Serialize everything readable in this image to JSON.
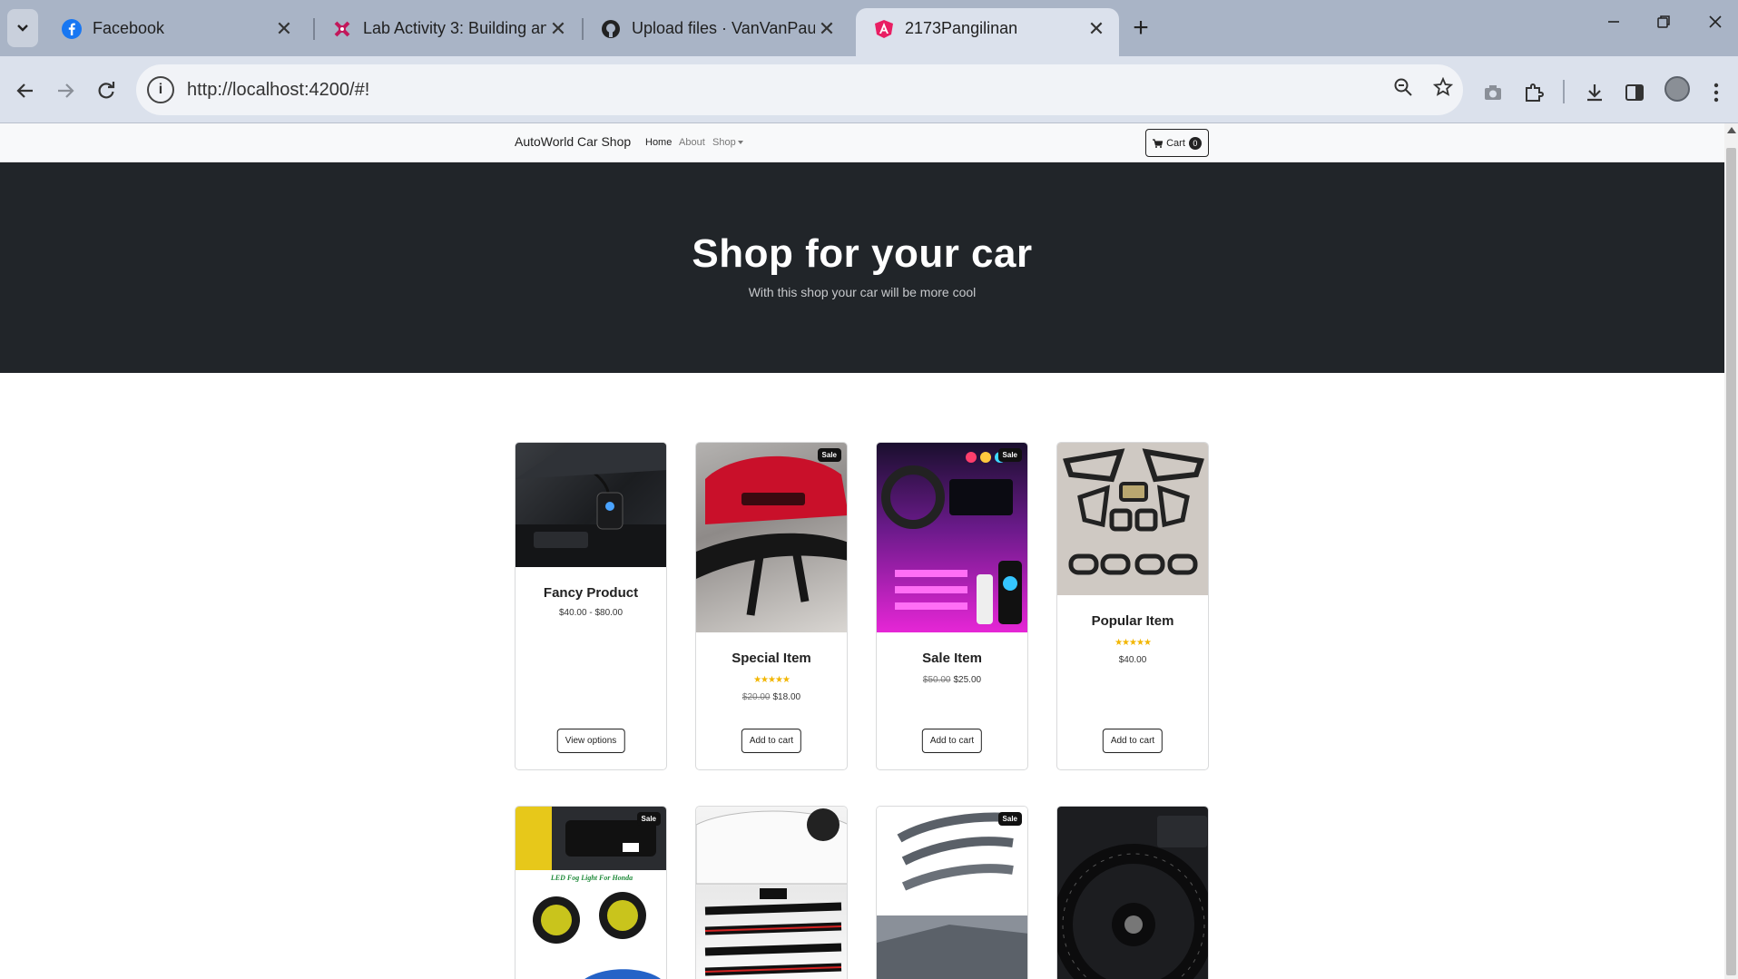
{
  "browser": {
    "tabs": [
      {
        "title": "Facebook",
        "favicon": "facebook-icon",
        "active": false
      },
      {
        "title": "Lab Activity 3: Building an SPA f",
        "favicon": "lab-icon",
        "active": false
      },
      {
        "title": "Upload files · VanVanPaulPaul/L",
        "favicon": "github-icon",
        "active": false
      },
      {
        "title": "2173Pangilinan",
        "favicon": "angular-icon",
        "active": true
      }
    ],
    "close_glyph": "✕",
    "new_tab_glyph": "+",
    "url": "http://localhost:4200/#!",
    "accent_color": "#dbe1ec",
    "tabstrip_color": "#a9b4c6"
  },
  "navbar": {
    "brand": "AutoWorld Car Shop",
    "links": [
      "Home",
      "About",
      "Shop"
    ],
    "cart_label": "Cart",
    "cart_count": "0"
  },
  "hero": {
    "title": "Shop for your car",
    "subtitle": "With this shop your car will be more cool",
    "background": "#212529"
  },
  "products": [
    {
      "name": "Fancy Product",
      "price": "$40.00 - $80.00",
      "old_price": "",
      "stars": "",
      "button": "View options",
      "sale": ""
    },
    {
      "name": "Special Item",
      "price": "$18.00",
      "old_price": "$20.00",
      "stars": "★★★★★",
      "button": "Add to cart",
      "sale": "Sale"
    },
    {
      "name": "Sale Item",
      "price": "$25.00",
      "old_price": "$50.00",
      "stars": "",
      "button": "Add to cart",
      "sale": "Sale"
    },
    {
      "name": "Popular Item",
      "price": "$40.00",
      "old_price": "",
      "stars": "★★★★★",
      "button": "Add to cart",
      "sale": ""
    },
    {
      "sale": "Sale",
      "image_caption": "LED Fog Light For Honda"
    },
    {
      "sale": ""
    },
    {
      "sale": "Sale"
    },
    {
      "sale": ""
    }
  ]
}
